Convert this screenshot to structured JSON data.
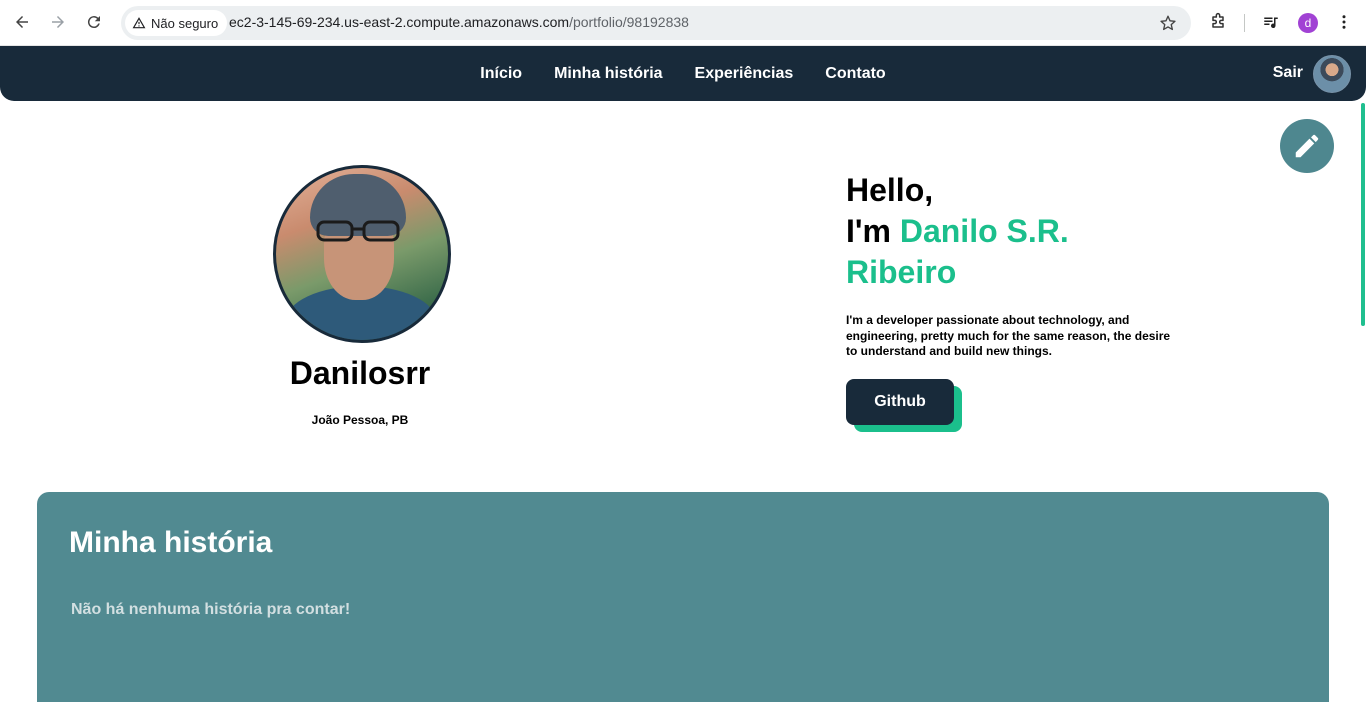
{
  "browser": {
    "security_label": "Não seguro",
    "url_host": "ec2-3-145-69-234.us-east-2.compute.amazonaws.com",
    "url_path": "/portfolio/98192838",
    "profile_initial": "d"
  },
  "header": {
    "nav": [
      "Início",
      "Minha história",
      "Experiências",
      "Contato"
    ],
    "logout_label": "Sair"
  },
  "profile": {
    "name": "Danilosrr",
    "location": "João Pessoa, PB"
  },
  "hero": {
    "greeting": "Hello,",
    "intro": "I'm ",
    "name_part1": "Danilo S.R.",
    "name_part2": "Ribeiro",
    "description": "I'm a developer passionate about technology, and engineering, pretty much for the same reason, the desire to understand and build new things.",
    "github_label": "Github"
  },
  "history": {
    "title": "Minha história",
    "empty_message": "Não há nenhuma história pra contar!"
  },
  "colors": {
    "header_bg": "#182a3a",
    "accent": "#1bbf8c",
    "section_bg": "#518a91"
  }
}
